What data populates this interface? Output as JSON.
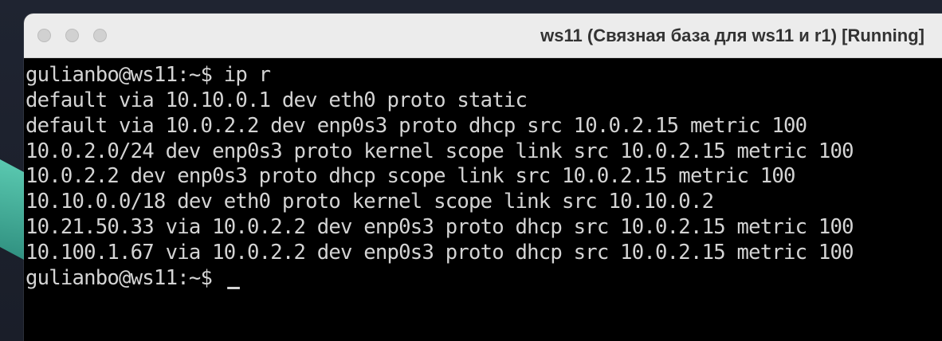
{
  "window": {
    "title": "ws11 (Связная база для ws11 и r1) [Running]"
  },
  "terminal": {
    "lines": [
      "gulianbo@ws11:~$ ip r",
      "default via 10.10.0.1 dev eth0 proto static",
      "default via 10.0.2.2 dev enp0s3 proto dhcp src 10.0.2.15 metric 100",
      "10.0.2.0/24 dev enp0s3 proto kernel scope link src 10.0.2.15 metric 100",
      "10.0.2.2 dev enp0s3 proto dhcp scope link src 10.0.2.15 metric 100",
      "10.10.0.0/18 dev eth0 proto kernel scope link src 10.10.0.2",
      "10.21.50.33 via 10.0.2.2 dev enp0s3 proto dhcp src 10.0.2.15 metric 100",
      "10.100.1.67 via 10.0.2.2 dev enp0s3 proto dhcp src 10.0.2.15 metric 100"
    ],
    "prompt": "gulianbo@ws11:~$ "
  },
  "colors": {
    "terminal_bg": "#000000",
    "terminal_fg": "#d4d4d4",
    "titlebar_bg": "#ececec"
  }
}
